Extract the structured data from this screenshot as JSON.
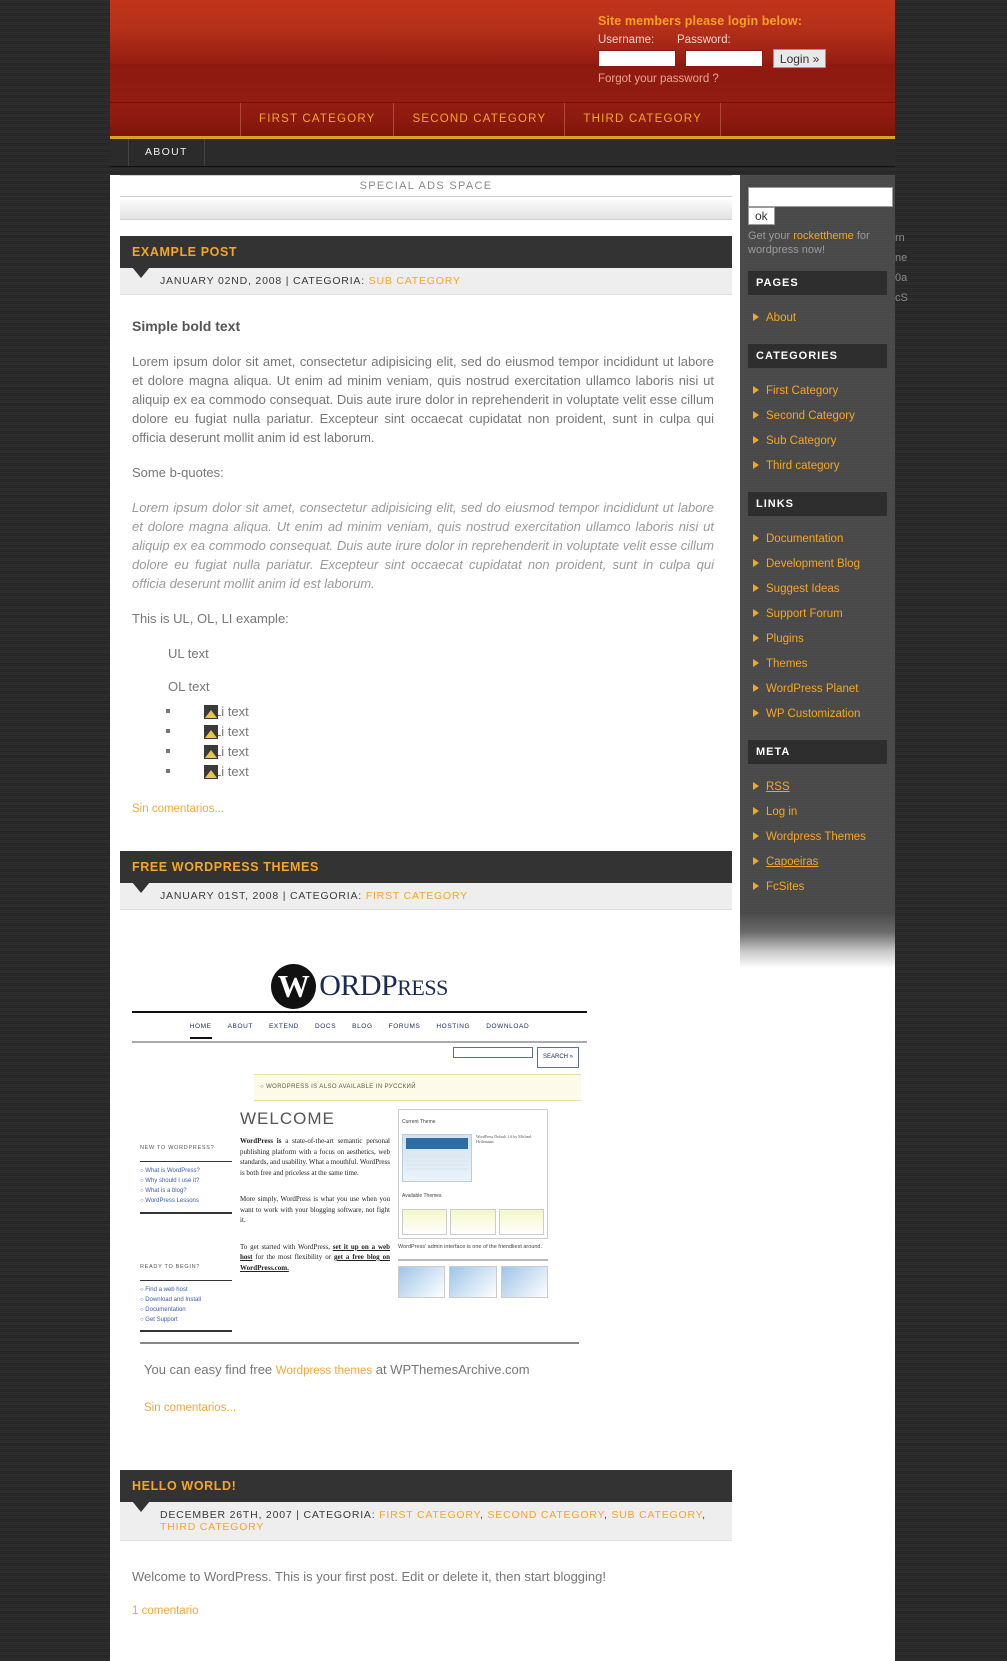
{
  "header": {
    "login": {
      "title": "Site members please login below:",
      "username_label": "Username:",
      "password_label": "Password:",
      "username_value": "",
      "password_value": "",
      "login_button": "Login »",
      "forgot_link": "Forgot your password ?"
    }
  },
  "nav": {
    "categories": [
      "FIRST CATEGORY",
      "SECOND CATEGORY",
      "THIRD CATEGORY"
    ],
    "pages": [
      "ABOUT"
    ]
  },
  "ads": {
    "label": "SPECIAL ADS SPACE"
  },
  "posts": [
    {
      "title": "EXAMPLE POST",
      "date": "JANUARY 02ND, 2008",
      "meta_prefix": "| CATEGORIA:",
      "categories": [
        "SUB CATEGORY"
      ],
      "heading": "Simple bold text",
      "paragraph": "Lorem ipsum dolor sit amet, consectetur adipisicing elit, sed do eiusmod tempor incididunt ut labore et dolore magna aliqua. Ut enim ad minim veniam, quis nostrud exercitation ullamco laboris nisi ut aliquip ex ea commodo consequat. Duis aute irure dolor in reprehenderit in voluptate velit esse cillum dolore eu fugiat nulla pariatur. Excepteur sint occaecat cupidatat non proident, sunt in culpa qui officia deserunt mollit anim id est laborum.",
      "quote_intro": "Some b-quotes:",
      "blockquote": "Lorem ipsum dolor sit amet, consectetur adipisicing elit, sed do eiusmod tempor incididunt ut labore et dolore magna aliqua. Ut enim ad minim veniam, quis nostrud exercitation ullamco laboris nisi ut aliquip ex ea commodo consequat. Duis aute irure dolor in reprehenderit in voluptate velit esse cillum dolore eu fugiat nulla pariatur. Excepteur sint occaecat cupidatat non proident, sunt in culpa qui officia deserunt mollit anim id est laborum.",
      "list_intro": "This is UL, OL, LI example:",
      "ul_text": "UL text",
      "ol_text": "OL text",
      "li_items": [
        "Li text",
        "Li text",
        "Li text",
        "Li text"
      ],
      "comments_link": "Sin comentarios..."
    },
    {
      "title": "FREE WORDPRESS THEMES",
      "date": "JANUARY 01ST, 2008",
      "meta_prefix": "| CATEGORIA:",
      "categories": [
        "FIRST CATEGORY"
      ],
      "find_text_pre": "You can easy find free",
      "find_link": "Wordpress themes",
      "find_text_post": "at WPThemesArchive.com",
      "comments_link": "Sin comentarios..."
    },
    {
      "title": "HELLO WORLD!",
      "date": "DECEMBER 26TH, 2007",
      "meta_prefix": "| CATEGORIA:",
      "categories": [
        "FIRST CATEGORY",
        "SECOND CATEGORY",
        "SUB CATEGORY",
        "THIRD CATEGORY"
      ],
      "body": "Welcome to WordPress. This is your first post. Edit or delete it, then start blogging!",
      "comments_link": "1 comentario"
    }
  ],
  "wp_screenshot": {
    "logo_w": "W",
    "logo_word": "ORD",
    "logo_word2": "RESS",
    "logo_p": "P",
    "nav": [
      "HOME",
      "ABOUT",
      "EXTEND",
      "DOCS",
      "BLOG",
      "FORUMS",
      "HOSTING",
      "DOWNLOAD"
    ],
    "search_button": "SEARCH »",
    "search_value": "",
    "notice": "○ WORDPRESS IS ALSO AVAILABLE IN РУССКИЙ",
    "col1_head1": "NEW TO WORDPRESS?",
    "col1_links1": [
      "○ What is WordPress?",
      "○ Why should I use it?",
      "○ What is a blog?",
      "○ WordPress Lessons"
    ],
    "col1_head2": "READY TO BEGIN?",
    "col1_links2": [
      "○ Find a web host",
      "○ Download and Install",
      "○ Documentation",
      "○ Get Support"
    ],
    "welcome": "WELCOME",
    "p1_bold": "WordPress is",
    "p1": "a state-of-the-art semantic personal publishing platform with a focus on aesthetics, web standards, and usability. What a mouthful. WordPress is both free and priceless at the same time.",
    "p2": "More simply, WordPress is what you use when you want to work with your blogging software, not fight it.",
    "p3_pre": "To get started with WordPress,",
    "p3_link1": "set it up on a web host",
    "p3_mid": "for the most flexibility or",
    "p3_link2": "get a free blog on WordPress.com.",
    "panel_title": "Current Theme",
    "panel_sub": "WordPress Default 1.6 by Michael Heilemann",
    "panel_avail": "Available Themes",
    "caption": "WordPress' admin interface is one of the friendliest around."
  },
  "sidebar": {
    "search_value": "",
    "ok_button": "ok",
    "promo_pre": "Get your",
    "promo_link": "rockettheme",
    "promo_post": "for wordpress now!",
    "sections": [
      {
        "heading": "PAGES",
        "items": [
          {
            "label": "About",
            "underline": false
          }
        ]
      },
      {
        "heading": "CATEGORIES",
        "items": [
          {
            "label": "First Category",
            "underline": false
          },
          {
            "label": "Second Category",
            "underline": false
          },
          {
            "label": "Sub Category",
            "underline": false
          },
          {
            "label": "Third category",
            "underline": false
          }
        ]
      },
      {
        "heading": "LINKS",
        "items": [
          {
            "label": "Documentation",
            "underline": false
          },
          {
            "label": "Development Blog",
            "underline": false
          },
          {
            "label": "Suggest Ideas",
            "underline": false
          },
          {
            "label": "Support Forum",
            "underline": false
          },
          {
            "label": "Plugins",
            "underline": false
          },
          {
            "label": "Themes",
            "underline": false
          },
          {
            "label": "WordPress Planet",
            "underline": false
          },
          {
            "label": "WP Customization",
            "underline": false
          }
        ]
      },
      {
        "heading": "META",
        "items": [
          {
            "label": "RSS",
            "underline": true
          },
          {
            "label": "Log in",
            "underline": false
          },
          {
            "label": "Wordpress Themes",
            "underline": false
          },
          {
            "label": "Capoeiras",
            "underline": true
          },
          {
            "label": "FcSites",
            "underline": false
          }
        ]
      }
    ]
  },
  "ghost_column": {
    "lines": [
      "rn",
      "ne",
      "0a",
      "",
      "cS"
    ]
  },
  "colors": {
    "accent": "#f5a623",
    "header_red": "#b4301a",
    "nav_gold": "#d9a320",
    "dark": "#2e2e2e",
    "sidebar": "#4a4a4a"
  }
}
